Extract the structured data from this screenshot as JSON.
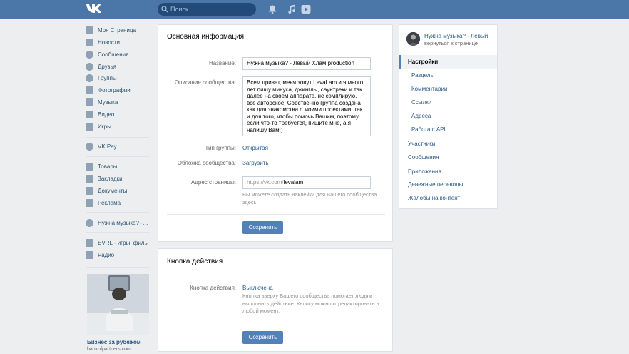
{
  "header": {
    "search_placeholder": "Поиск"
  },
  "nav": {
    "items": [
      {
        "label": "Моя Страница",
        "icon": "home-icon"
      },
      {
        "label": "Новости",
        "icon": "news-icon"
      },
      {
        "label": "Сообщения",
        "icon": "messages-icon"
      },
      {
        "label": "Друзья",
        "icon": "friends-icon"
      },
      {
        "label": "Группы",
        "icon": "groups-icon"
      },
      {
        "label": "Фотографии",
        "icon": "photos-icon"
      },
      {
        "label": "Музыка",
        "icon": "music-icon"
      },
      {
        "label": "Видео",
        "icon": "video-icon"
      },
      {
        "label": "Игры",
        "icon": "games-icon"
      },
      {
        "label": "VK Pay",
        "icon": "vkpay-icon"
      },
      {
        "label": "Товары",
        "icon": "goods-icon"
      },
      {
        "label": "Закладки",
        "icon": "bookmarks-icon"
      },
      {
        "label": "Документы",
        "icon": "documents-icon"
      },
      {
        "label": "Реклама",
        "icon": "ads-icon"
      },
      {
        "label": "Нужна музыка? -…",
        "icon": "community-icon"
      },
      {
        "label": "EVRL - игры, филь",
        "icon": "app-icon"
      },
      {
        "label": "Радио",
        "icon": "radio-icon"
      }
    ]
  },
  "ad": {
    "title": "Бизнес за рубежом",
    "domain": "bankofpartners.com"
  },
  "basic_info": {
    "title": "Основная информация",
    "name_label": "Название:",
    "name_value": "Нужна музыка? -  Левый Хлам production",
    "description_label": "Описание сообщества:",
    "description_value": "Всем привет, меня зовут LevaLam и я много лет пишу минуса, джинглы, саунтреки и так далее на своем аппарате, не сэмплирую, все авторское. Собственно группа создана как для знакомства с моими проектами, так и для того, чтобы помочь Вашим, поэтому если что-то требуется, пишите мне, а я напишу Вам;)",
    "group_type_label": "Тип группы:",
    "group_type_value": "Открытая",
    "cover_label": "Обложка сообщества:",
    "cover_value": "Загрузить",
    "address_label": "Адрес страницы:",
    "address_prefix": "https://vk.com/",
    "address_value": "levalam",
    "address_hint": "Вы можете создать наклейки для Вашего сообщества здесь",
    "save_label": "Сохранить"
  },
  "action_button": {
    "title": "Кнопка действия",
    "label": "Кнопка действия:",
    "value": "Выключена",
    "hint": "Кнопка вверху Вашего сообщества помогает людям выполнить действие. Кнопку можно отредактировать в любой момент.",
    "save_label": "Сохранить"
  },
  "right_menu": {
    "community_name": "Нужна музыка? - Левый",
    "back_label": "вернуться к странице",
    "items": [
      {
        "label": "Настройки",
        "active": true,
        "sub": false
      },
      {
        "label": "Разделы",
        "active": false,
        "sub": true
      },
      {
        "label": "Комментарии",
        "active": false,
        "sub": true
      },
      {
        "label": "Ссылки",
        "active": false,
        "sub": true
      },
      {
        "label": "Адреса",
        "active": false,
        "sub": true
      },
      {
        "label": "Работа с API",
        "active": false,
        "sub": true
      },
      {
        "label": "Участники",
        "active": false,
        "sub": false
      },
      {
        "label": "Сообщения",
        "active": false,
        "sub": false
      },
      {
        "label": "Приложения",
        "active": false,
        "sub": false
      },
      {
        "label": "Денежные переводы",
        "active": false,
        "sub": false
      },
      {
        "label": "Жалобы на контент",
        "active": false,
        "sub": false
      }
    ]
  },
  "colors": {
    "header": "#4a76a8",
    "link": "#2a5885",
    "button": "#5181b8",
    "background": "#edeef0"
  }
}
